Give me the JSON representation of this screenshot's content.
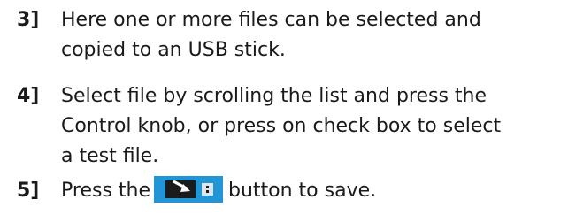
{
  "steps": [
    {
      "number": "3]",
      "lines": [
        "Here one or more files can be selected and",
        "copied to an USB stick."
      ]
    },
    {
      "number": "4]",
      "lines": [
        "Select file by scrolling the list and press the",
        "Control knob, or press on check box to select",
        "a test file."
      ]
    },
    {
      "number": "5]",
      "before_button": "Press the",
      "after_button": "button to save.",
      "button_icon": "usb-save-icon"
    }
  ],
  "colors": {
    "button_bg": "#2196d6",
    "usb_body": "#1b1b1b",
    "usb_cap": "#dde6ee",
    "text": "#1a1a1a"
  }
}
